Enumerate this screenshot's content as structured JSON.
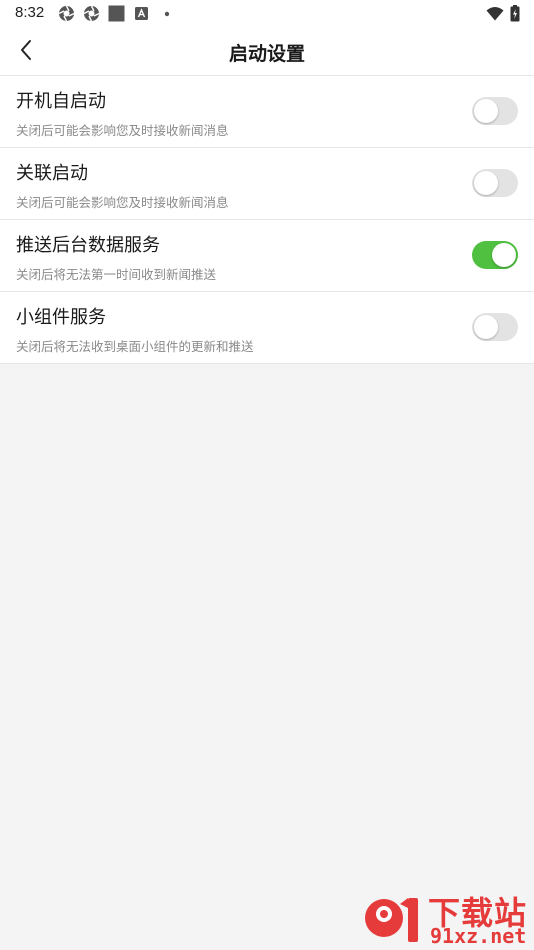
{
  "status_bar": {
    "time": "8:32",
    "left_icons": [
      "aperture-icon",
      "aperture-icon",
      "square-icon",
      "font-box-icon",
      "dot-icon"
    ],
    "right_icons": [
      "wifi-icon",
      "battery-charging-icon"
    ]
  },
  "header": {
    "back_icon": "chevron-left-icon",
    "title": "启动设置"
  },
  "settings": {
    "items": [
      {
        "title": "开机自启动",
        "desc": "关闭后可能会影响您及时接收新闻消息",
        "enabled": false
      },
      {
        "title": "关联启动",
        "desc": "关闭后可能会影响您及时接收新闻消息",
        "enabled": false
      },
      {
        "title": "推送后台数据服务",
        "desc": "关闭后将无法第一时间收到新闻推送",
        "enabled": true
      },
      {
        "title": "小组件服务",
        "desc": "关闭后将无法收到桌面小组件的更新和推送",
        "enabled": false
      }
    ]
  },
  "watermark": {
    "logo_text": "91",
    "text_cn": "下载站",
    "text_en": "91xz.net"
  },
  "colors": {
    "toggle_on": "#4fc03f",
    "toggle_off": "#e3e3e3",
    "watermark": "#e53b3b",
    "background": "#f4f4f4"
  }
}
